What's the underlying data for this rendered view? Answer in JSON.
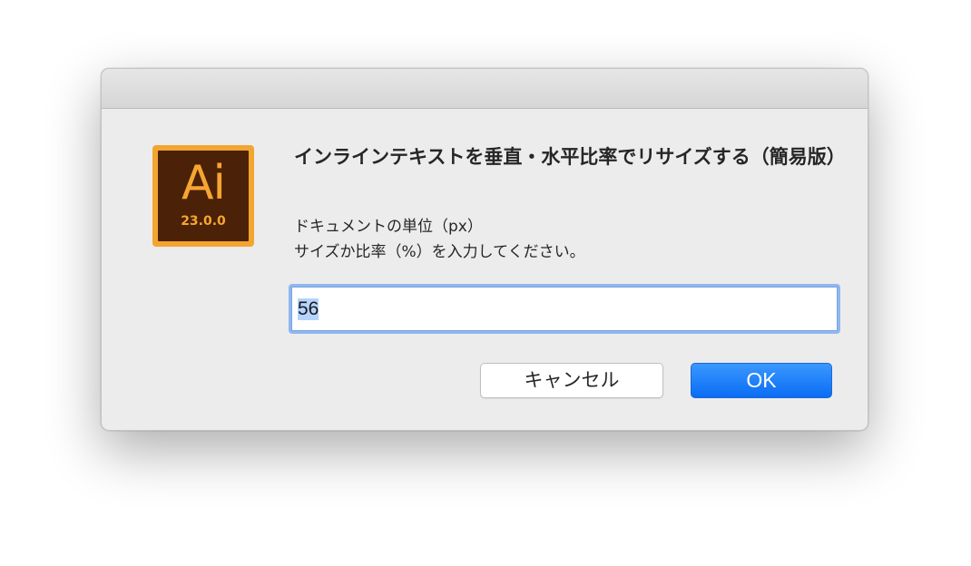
{
  "app_icon": {
    "letters": "Ai",
    "version": "23.0.0",
    "icon_name": "adobe-illustrator-icon",
    "colors": {
      "frame": "#f3a531",
      "fill": "#4b2107",
      "text": "#f7a532"
    }
  },
  "dialog": {
    "title": "インラインテキストを垂直・水平比率でリサイズする（簡易版）",
    "body_lines": [
      "ドキュメントの単位（px）",
      "サイズか比率（%）を入力してください。"
    ]
  },
  "input": {
    "value": "56"
  },
  "buttons": {
    "cancel_label": "キャンセル",
    "ok_label": "OK"
  },
  "colors": {
    "accent": "#0a6cf3",
    "focus_ring": "#8fb7f0"
  }
}
